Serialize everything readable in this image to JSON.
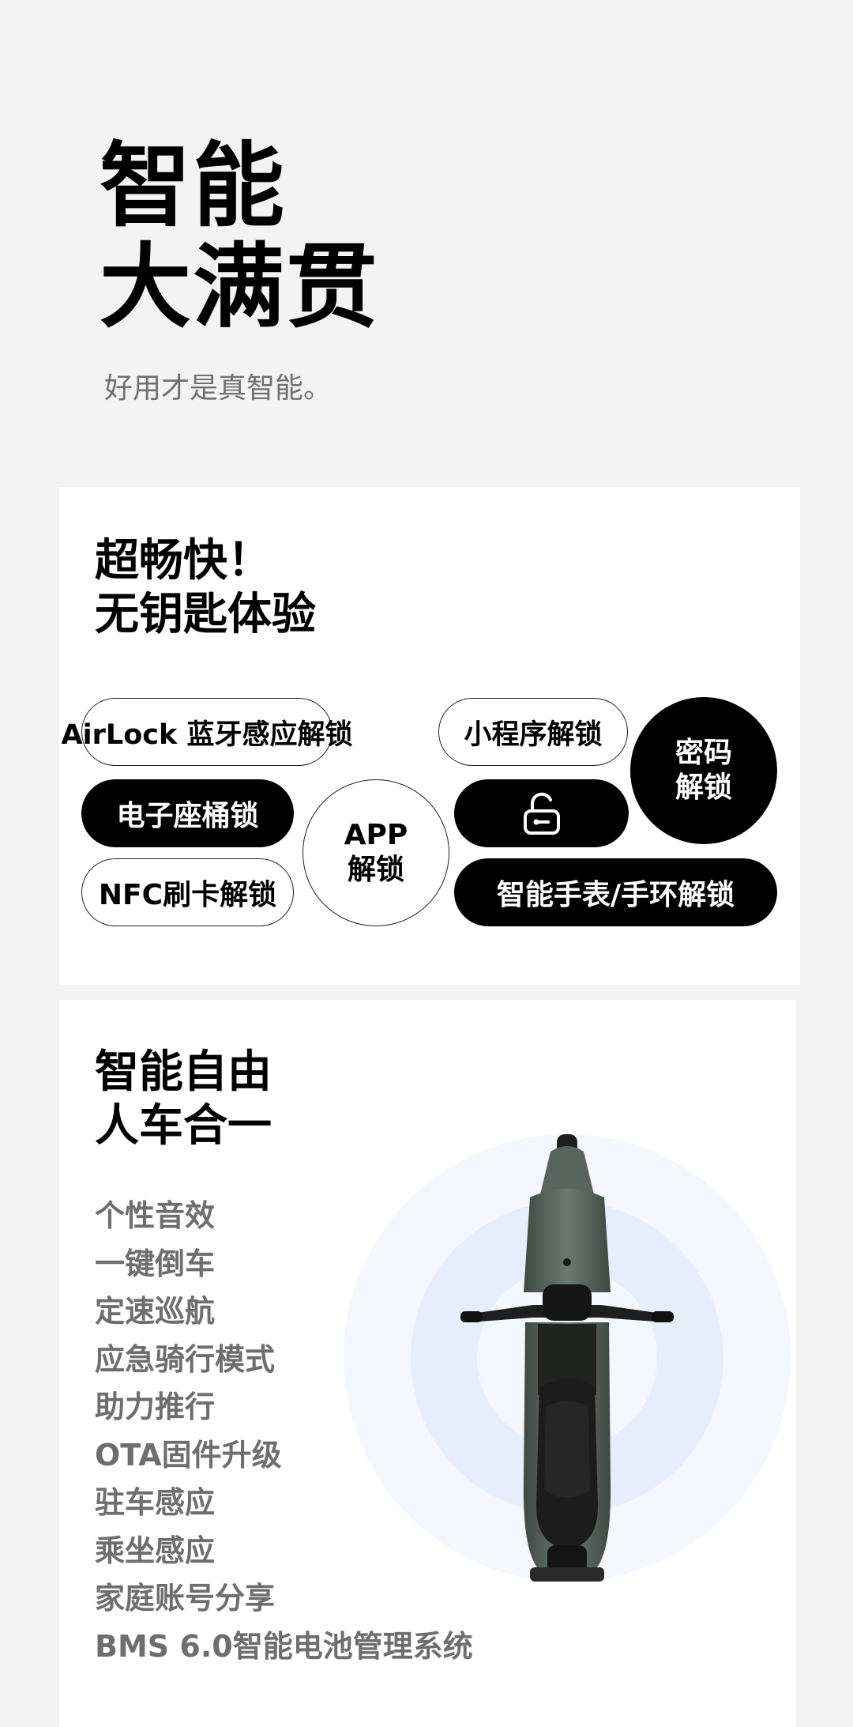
{
  "hero": {
    "title_line1": "智能",
    "title_line2": "大满贯",
    "subtitle": "好用才是真智能。"
  },
  "keyless": {
    "title": "超畅快！\n无钥匙体验",
    "methods": {
      "airlock": "AirLock 蓝牙感应解锁",
      "mini_program": "小程序解锁",
      "password": "密码\n解锁",
      "seat_lock": "电子座桶锁",
      "app": "APP\n解锁",
      "lock_icon": "unlock-icon",
      "nfc": "NFC刷卡解锁",
      "watch": "智能手表/手环解锁"
    }
  },
  "smart": {
    "title": "智能自由\n人车合一",
    "features": [
      "个性音效",
      "一键倒车",
      "定速巡航",
      "应急骑行模式",
      "助力推行",
      "OTA固件升级",
      "驻车感应",
      "乘坐感应",
      "家庭账号分享",
      "BMS 6.0智能电池管理系统"
    ],
    "visual_icon": "scooter-top-view-icon"
  },
  "colors": {
    "background": "#f3f3f3",
    "card": "#ffffff",
    "primary": "#000000",
    "secondary_text": "#6e6e6e",
    "ring_light": "#f3f6fd",
    "ring_mid": "#e6eefb",
    "scooter_body": "#5f6c66"
  }
}
